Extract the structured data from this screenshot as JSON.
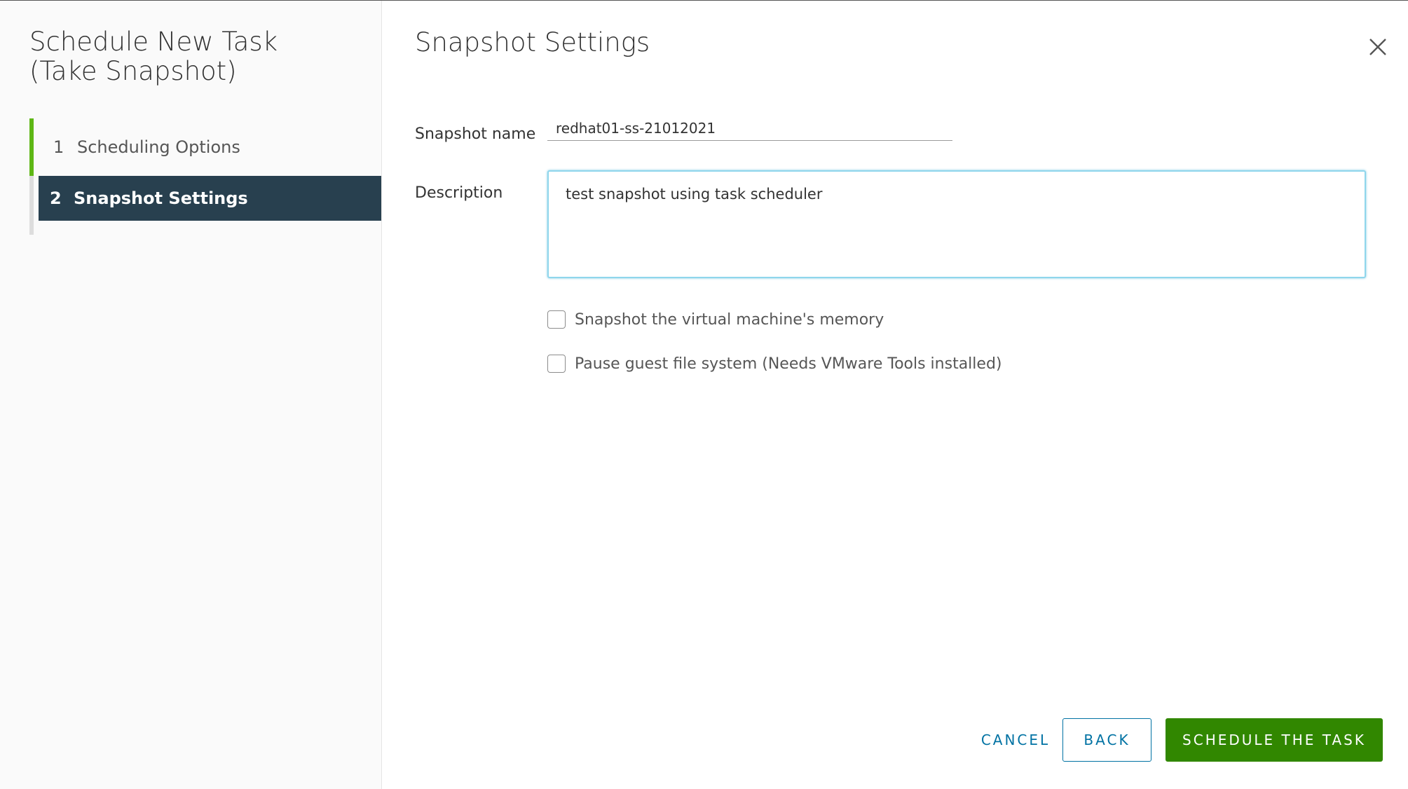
{
  "wizard": {
    "title_line1": "Schedule New Task",
    "title_line2": "(Take Snapshot)",
    "steps": [
      {
        "number": "1",
        "label": "Scheduling Options",
        "state": "completed"
      },
      {
        "number": "2",
        "label": "Snapshot Settings",
        "state": "active"
      }
    ]
  },
  "main": {
    "title": "Snapshot Settings",
    "close_icon": "close-icon",
    "snapshot_name": {
      "label": "Snapshot name",
      "value": "redhat01-ss-21012021"
    },
    "description": {
      "label": "Description",
      "value": "test snapshot using task scheduler"
    },
    "options": [
      {
        "label": "Snapshot the virtual machine's memory",
        "checked": false
      },
      {
        "label": "Pause guest file system (Needs VMware Tools installed)",
        "checked": false
      }
    ]
  },
  "footer": {
    "cancel_label": "CANCEL",
    "back_label": "BACK",
    "schedule_label": "SCHEDULE THE TASK"
  },
  "colors": {
    "accent_green": "#5eb715",
    "active_step_bg": "#28404f",
    "primary_button": "#318700",
    "link_blue": "#0072a3",
    "focus_border": "#8fd6ec"
  }
}
